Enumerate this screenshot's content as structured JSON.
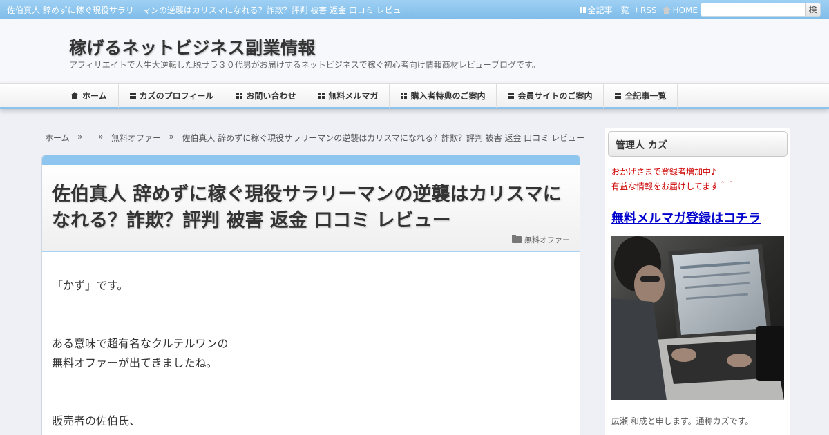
{
  "topbar": {
    "lead": "佐伯真人 辞めずに稼ぐ現役サラリーマンの逆襲はカリスマになれる？詐欺？評判 被害 返金 口コミ レビュー",
    "links": [
      "全記事一覧",
      "RSS",
      "HOME"
    ],
    "search_placeholder": "",
    "search_button": "検索"
  },
  "header": {
    "title": "稼げるネットビジネス副業情報",
    "description": "アフィリエイトで人生大逆転した脱サラ３０代男がお届けするネットビジネスで稼ぐ初心者向け情報商材レビューブログです。"
  },
  "nav": {
    "items": [
      "ホーム",
      "カズのプロフィール",
      "お問い合わせ",
      "無料メルマガ",
      "購入者特典のご案内",
      "会員サイトのご案内",
      "全記事一覧"
    ]
  },
  "breadcrumb": {
    "home": "ホーム",
    "sep": "»",
    "category": "無料オファー",
    "current": "佐伯真人 辞めずに稼ぐ現役サラリーマンの逆襲はカリスマになれる？詐欺？評判 被害 返金 口コミ レビュー"
  },
  "article": {
    "title": "佐伯真人 辞めずに稼ぐ現役サラリーマンの逆襲はカリスマになれる？詐欺？評判 被害 返金 口コミ レビュー",
    "category": "無料オファー",
    "paragraphs": [
      "「かず」です。",
      "ある意味で超有名なクルテルワンの",
      "無料オファーが出てきましたね。",
      "販売者の佐伯氏、"
    ]
  },
  "sidebar": {
    "widget_title": "管理人 カズ",
    "notice_line1": "おかげさまで登録者増加中♪",
    "notice_line2": "有益な情報をお届けしてます＾＾",
    "signup_link": "無料メルマガ登録はコチラ",
    "intro": "広瀬 和成と申します。通称カズです。"
  },
  "colors": {
    "topbar": "#8fc7f0",
    "accent": "#8ec6ef",
    "notice": "#cc0000",
    "link": "#0000cc"
  }
}
